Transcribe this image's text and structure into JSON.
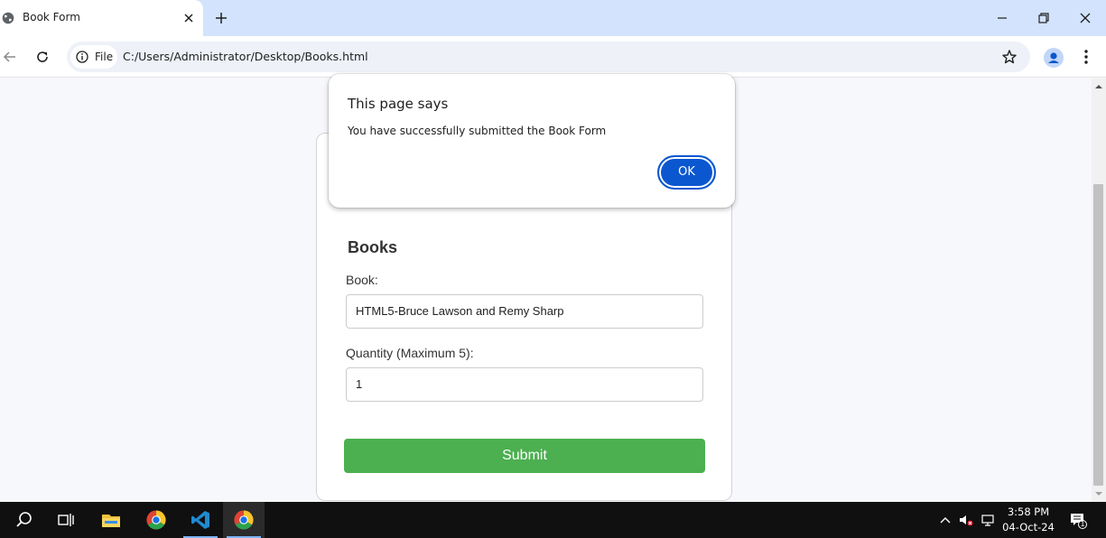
{
  "browser": {
    "tab": {
      "title": "Book Form"
    },
    "address": {
      "chip_label": "File",
      "url": "C:/Users/Administrator/Desktop/Books.html"
    }
  },
  "form": {
    "title": "Books",
    "book_label": "Book:",
    "book_value": "HTML5-Bruce Lawson and Remy Sharp",
    "quantity_label": "Quantity (Maximum 5):",
    "quantity_value": "1",
    "submit_label": "Submit"
  },
  "dialog": {
    "title": "This page says",
    "message": "You have successfully submitted the Book Form",
    "ok_label": "OK"
  },
  "taskbar": {
    "time": "3:58 PM",
    "date": "04-Oct-24",
    "notification_count": "1"
  },
  "colors": {
    "submit": "#4caf50",
    "ok_button": "#0b57d0",
    "tab_strip": "#d3e3fd",
    "taskbar": "#101010"
  },
  "icons": [
    "globe-icon",
    "close-icon",
    "plus-icon",
    "minimize-icon",
    "restore-icon",
    "back-icon",
    "reload-icon",
    "info-icon",
    "star-icon",
    "profile-icon",
    "more-icon",
    "search-icon",
    "task-view-icon",
    "file-explorer-icon",
    "chrome-icon",
    "vscode-icon",
    "chevron-up-icon",
    "volume-muted-icon",
    "network-icon",
    "notification-icon"
  ]
}
